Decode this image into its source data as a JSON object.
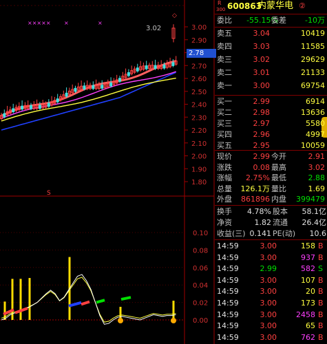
{
  "colors": {
    "up": "#ff4040",
    "down": "#40e0e0",
    "ma5": "#ffffff",
    "ma10": "#ffff40",
    "ma20": "#ff40ff",
    "ma60": "#2040ff"
  },
  "header": {
    "code_prefix": "R",
    "code_prefix2": "300",
    "code": "600863",
    "name": "内蒙华电",
    "badge": "②"
  },
  "ratio": {
    "label1": "委比",
    "value1": "-55.15%",
    "label2": "委差",
    "value2": "-10万"
  },
  "asks": [
    {
      "label": "卖五",
      "price": "3.04",
      "vol": "10419"
    },
    {
      "label": "卖四",
      "price": "3.03",
      "vol": "11585"
    },
    {
      "label": "卖三",
      "price": "3.02",
      "vol": "29629"
    },
    {
      "label": "卖二",
      "price": "3.01",
      "vol": "21133"
    },
    {
      "label": "卖一",
      "price": "3.00",
      "vol": "69754"
    }
  ],
  "bids": [
    {
      "label": "买一",
      "price": "2.99",
      "vol": "6914"
    },
    {
      "label": "买二",
      "price": "2.98",
      "vol": "13636"
    },
    {
      "label": "买三",
      "price": "2.97",
      "vol": "5580"
    },
    {
      "label": "买四",
      "price": "2.96",
      "vol": "4997"
    },
    {
      "label": "买五",
      "price": "2.95",
      "vol": "10059"
    }
  ],
  "quote": [
    {
      "l1": "现价",
      "v1": "2.99",
      "l2": "今开",
      "v2": "2.91"
    },
    {
      "l1": "涨跌",
      "v1": "0.08",
      "l2": "最高",
      "v2": "3.02"
    },
    {
      "l1": "涨幅",
      "v1": "2.75%",
      "l2": "最低",
      "v2": "2.88"
    },
    {
      "l1": "总量",
      "v1": "126.1万",
      "l2": "量比",
      "v2": "1.69"
    },
    {
      "l1": "外盘",
      "v1": "861896",
      "l2": "内盘",
      "v2": "399479"
    }
  ],
  "stats": [
    {
      "l1": "换手",
      "v1": "4.78%",
      "l2": "股本",
      "v2": "58.1亿"
    },
    {
      "l1": "净资",
      "v1": "1.82",
      "l2": "流通",
      "v2": "26.4亿"
    },
    {
      "l1": "收益(三)",
      "v1": "0.141",
      "l2": "PE(动)",
      "v2": "10.6"
    }
  ],
  "ticks": [
    {
      "time": "14:59",
      "price": "3.00",
      "vol": "158",
      "side": "B"
    },
    {
      "time": "14:59",
      "price": "3.00",
      "vol": "937",
      "side": "B"
    },
    {
      "time": "14:59",
      "price": "2.99",
      "vol": "582",
      "side": "S"
    },
    {
      "time": "14:59",
      "price": "3.00",
      "vol": "107",
      "side": "B"
    },
    {
      "time": "14:59",
      "price": "3.00",
      "vol": "20",
      "side": "B"
    },
    {
      "time": "14:59",
      "price": "3.00",
      "vol": "173",
      "side": "B"
    },
    {
      "time": "14:59",
      "price": "3.00",
      "vol": "2458",
      "side": "B"
    },
    {
      "time": "14:59",
      "price": "3.00",
      "vol": "65",
      "side": "B"
    },
    {
      "time": "14:59",
      "price": "3.00",
      "vol": "762",
      "side": "B"
    }
  ],
  "price_axis": [
    "3.00",
    "2.90",
    "2.80",
    "2.70",
    "2.60",
    "2.50",
    "2.40",
    "2.30",
    "2.20",
    "2.10",
    "2.00",
    "1.90",
    "1.80"
  ],
  "price_marker": "2.78",
  "high_label": "3.02",
  "lower_axis": [
    "0.10",
    "0.08",
    "0.06",
    "0.04",
    "0.02",
    "0.00"
  ],
  "signal_marks": "×××××",
  "signal_mark2": "×",
  "signal_mark3": "×"
}
